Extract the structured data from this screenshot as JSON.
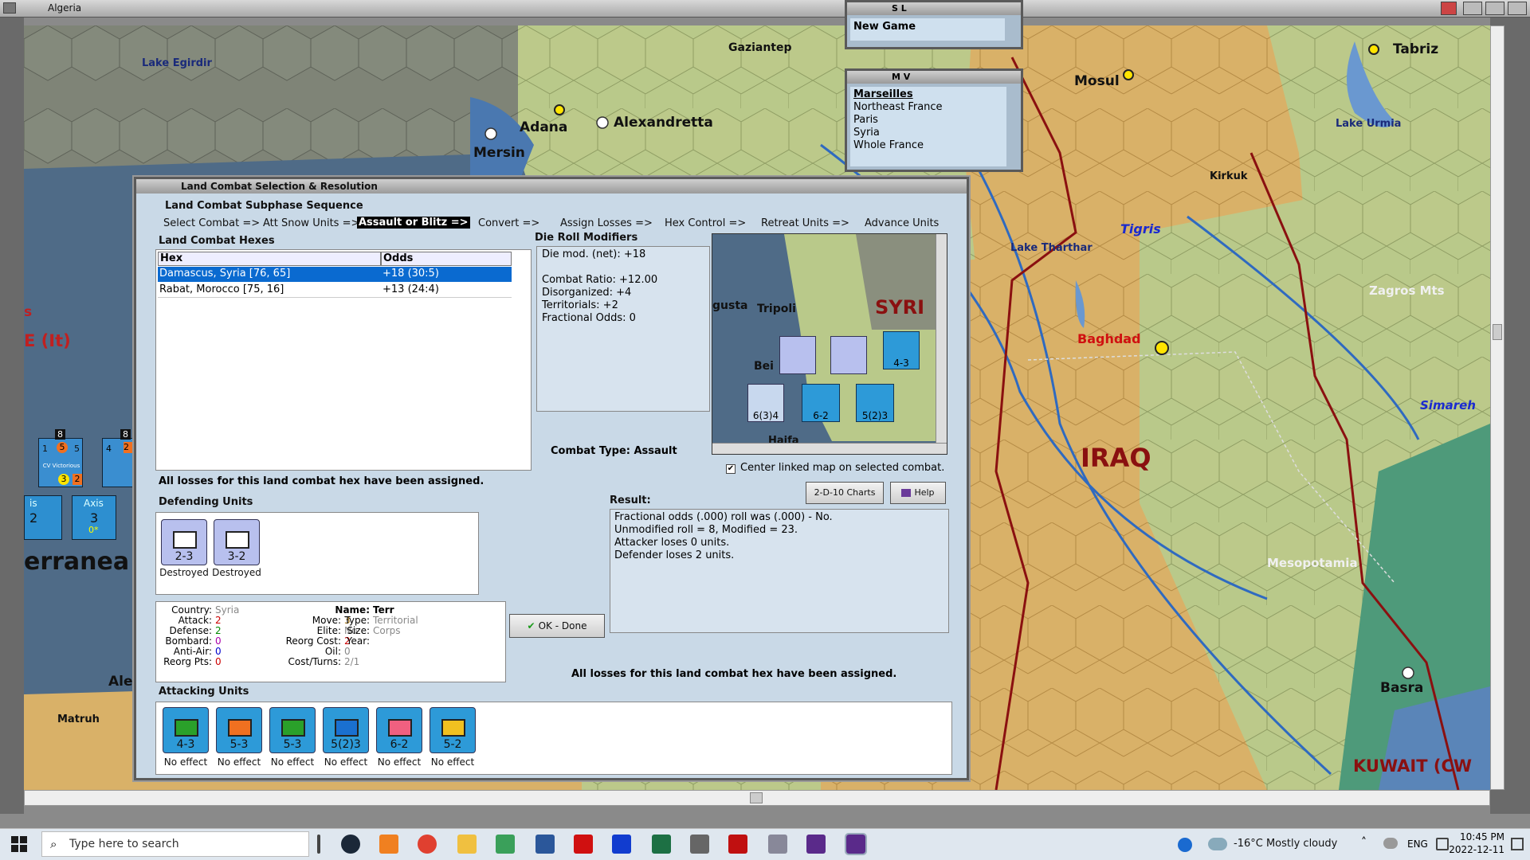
{
  "window_title": "Algeria",
  "map_labels": [
    {
      "text": "Lake Egirdir",
      "color": "#1a2a7a"
    },
    {
      "text": "Gaziantep",
      "color": "#111"
    },
    {
      "text": "Adana",
      "color": "#111"
    },
    {
      "text": "Alexandretta",
      "color": "#111"
    },
    {
      "text": "Mersin",
      "color": "#111"
    },
    {
      "text": "Mosul",
      "color": "#111"
    },
    {
      "text": "Tabriz",
      "color": "#111"
    },
    {
      "text": "Lake Urmia",
      "color": "#1a2a7a"
    },
    {
      "text": "Kirkuk",
      "color": "#111"
    },
    {
      "text": "Tigris",
      "color": "#1a2ad0"
    },
    {
      "text": "Lake Tharthar",
      "color": "#1a2a7a"
    },
    {
      "text": "Zagros Mts",
      "color": "#f0f0f0"
    },
    {
      "text": "Baghdad",
      "color": "#d01010"
    },
    {
      "text": "Simareh",
      "color": "#1a2ad0"
    },
    {
      "text": "IRAQ",
      "color": "#8a1010"
    },
    {
      "text": "Mesopotamia",
      "color": "#f0f0f0"
    },
    {
      "text": "Basra",
      "color": "#111"
    },
    {
      "text": "KUWAIT (CW",
      "color": "#8a1010"
    },
    {
      "text": "E (It)",
      "color": "#c02020"
    },
    {
      "text": "s",
      "color": "#c02020"
    },
    {
      "text": "erranea",
      "color": "#111"
    },
    {
      "text": "Ale",
      "color": "#111"
    },
    {
      "text": "Matruh",
      "color": "#111"
    }
  ],
  "sl_window": {
    "title": "S L",
    "item": "New Game"
  },
  "mv_window": {
    "title": "M V",
    "items": [
      "Marseilles",
      "Northeast France",
      "Paris",
      "Syria",
      "Whole France"
    ]
  },
  "left_panel": {
    "axis_label": "Axis",
    "axis_value": "3",
    "axis_sub": "0*",
    "is_label": "is",
    "is_value": "2",
    "unit_name": "CV Victorious",
    "unit_vals": [
      "1",
      "5",
      "5",
      "3",
      "2"
    ],
    "unit2_vals": [
      "4",
      "2"
    ],
    "top_num": "8",
    "top_num2": "8"
  },
  "dialog": {
    "title": "Land Combat Selection & Resolution",
    "sequence_label": "Land Combat Subphase Sequence",
    "sequence": [
      "Select Combat =>",
      "Att Snow Units =>",
      "Assault or Blitz =>",
      "Convert =>",
      "Assign Losses =>",
      "Hex Control =>",
      "Retreat Units =>",
      "Advance Units"
    ],
    "hexes_label": "Land Combat Hexes",
    "col_hex": "Hex",
    "col_odds": "Odds",
    "rows": [
      {
        "hex": "Damascus, Syria [76, 65]",
        "odds": "+18 (30:5)"
      },
      {
        "hex": "Rabat, Morocco [75, 16]",
        "odds": "+13 (24:4)"
      }
    ],
    "drm_label": "Die Roll Modifiers",
    "drm_lines": [
      "Die mod. (net): +18",
      "",
      "Combat Ratio: +12.00",
      "Disorganized: +4",
      "Territorials: +2",
      "Fractional Odds: 0"
    ],
    "combat_type": "Combat Type:  Assault",
    "center_linked": "Center linked map on selected combat.",
    "losses_msg": "All losses for this land combat hex have been assigned.",
    "defending_label": "Defending Units",
    "defenders": [
      {
        "v": "2-3",
        "status": "Destroyed"
      },
      {
        "v": "3-2",
        "status": "Destroyed"
      }
    ],
    "details": {
      "country_k": "Country:",
      "country_v": "Syria",
      "attack_k": "Attack:",
      "attack_v": "2",
      "defense_k": "Defense:",
      "defense_v": "2",
      "bombard_k": "Bombard:",
      "bombard_v": "0",
      "aa_k": "Anti-Air:",
      "aa_v": "0",
      "reorg_k": "Reorg Pts:",
      "reorg_v": "0",
      "move_k": "Move:",
      "move_v": "3",
      "elite_k": "Elite:",
      "elite_v": "No",
      "rcost_k": "Reorg Cost:",
      "rcost_v": "2",
      "oil_k": "Oil:",
      "oil_v": "0",
      "ct_k": "Cost/Turns:",
      "ct_v": "2/1",
      "name_k": "Name:",
      "name_v": "Terr",
      "type_k": "Type:",
      "type_v": "Territorial",
      "size_k": "Size:",
      "size_v": "Corps",
      "year_k": "Year:",
      "year_v": ""
    },
    "charts_btn": "2-D-10 Charts",
    "help_btn": "Help",
    "result_label": "Result:",
    "result_lines": [
      "Fractional odds (.000) roll was (.000)  - No.",
      "Unmodified roll = 8, Modified = 23.",
      "Attacker loses 0 units.",
      "Defender loses 2 units."
    ],
    "ok_btn": "OK - Done",
    "losses_msg2": "All losses for this land combat hex have been assigned.",
    "attacking_label": "Attacking Units",
    "attackers": [
      {
        "v": "4-3",
        "status": "No effect",
        "color": "#2d9ad8"
      },
      {
        "v": "5-3",
        "status": "No effect",
        "color": "#2d9ad8"
      },
      {
        "v": "5-3",
        "status": "No effect",
        "color": "#2d9ad8"
      },
      {
        "v": "5(2)3",
        "status": "No effect",
        "color": "#2d9ad8"
      },
      {
        "v": "6-2",
        "status": "No effect",
        "color": "#2d9ad8"
      },
      {
        "v": "5-2",
        "status": "No effect",
        "color": "#2d9ad8"
      }
    ],
    "minimap": {
      "labels": [
        "gusta",
        "Tripoli",
        "SYRI",
        "Bei",
        "Haifa"
      ],
      "units": [
        "6(3)4",
        "6-2",
        "5(2)3",
        "4-3"
      ]
    }
  },
  "taskbar": {
    "search_placeholder": "Type here to search",
    "weather": "-16°C  Mostly cloudy",
    "lang": "ENG",
    "time": "10:45 PM",
    "date": "2022-12-11"
  }
}
